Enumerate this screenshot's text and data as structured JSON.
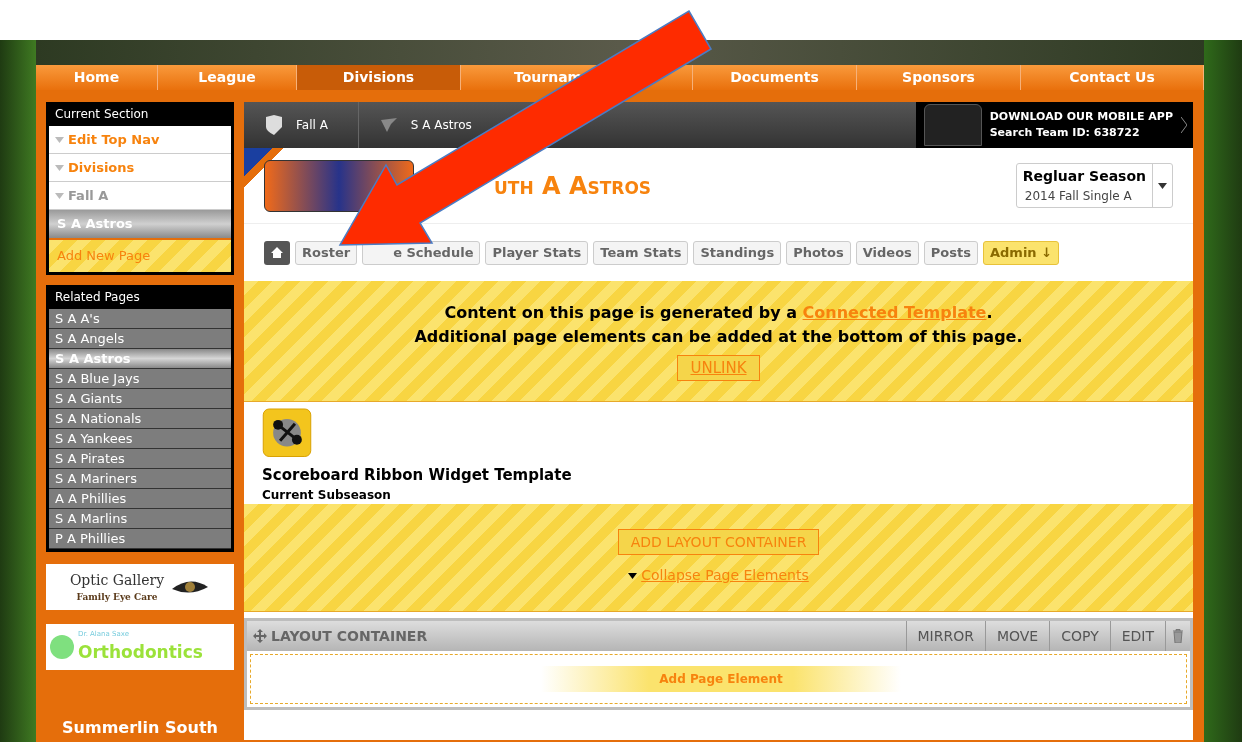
{
  "nav": [
    {
      "label": "Home",
      "selected": false
    },
    {
      "label": "League",
      "selected": false
    },
    {
      "label": "Divisions",
      "selected": true
    },
    {
      "label": "Tournam",
      "selected": false
    },
    {
      "label": "Documents",
      "selected": false
    },
    {
      "label": "Sponsors",
      "selected": false
    },
    {
      "label": "Contact Us",
      "selected": false
    }
  ],
  "current_section": {
    "title": "Current Section",
    "items": [
      {
        "label": "Edit Top Nav",
        "kind": "link"
      },
      {
        "label": "Divisions",
        "kind": "link"
      },
      {
        "label": "Fall A",
        "kind": "muted"
      },
      {
        "label": "S A Astros",
        "kind": "current"
      },
      {
        "label": "Add New Page",
        "kind": "add"
      }
    ]
  },
  "related_pages": {
    "title": "Related Pages",
    "items": [
      {
        "label": "S A A's",
        "selected": false
      },
      {
        "label": "S A Angels",
        "selected": false
      },
      {
        "label": "S A Astros",
        "selected": true
      },
      {
        "label": "S A Blue Jays",
        "selected": false
      },
      {
        "label": "S A Giants",
        "selected": false
      },
      {
        "label": "S A Nationals",
        "selected": false
      },
      {
        "label": "S A Yankees",
        "selected": false
      },
      {
        "label": "S A Pirates",
        "selected": false
      },
      {
        "label": "S A Mariners",
        "selected": false
      },
      {
        "label": "A A Phillies",
        "selected": false
      },
      {
        "label": "S A Marlins",
        "selected": false
      },
      {
        "label": "P A Phillies",
        "selected": false
      }
    ]
  },
  "sponsors": [
    {
      "title": "Optic Gallery",
      "subtitle": "Family Eye Care",
      "kind": "optic"
    },
    {
      "title": "Orthodontics",
      "subtitle": "Dr. Alana Saxe",
      "kind": "ortho"
    },
    {
      "title": "Summerlin South",
      "kind": "league"
    }
  ],
  "breadcrumbs": [
    "Fall A",
    "S A Astros"
  ],
  "app_promo": {
    "title": "DOWNLOAD OUR MOBILE APP",
    "subtitle": "Search Team ID: 638722"
  },
  "team_title": "uth A Astros",
  "season": {
    "title": "Regluar Season",
    "subtitle": "2014 Fall Single A"
  },
  "tabs": [
    {
      "kind": "home"
    },
    {
      "label": "Roster",
      "kind": "tab"
    },
    {
      "label": "e Schedule",
      "kind": "tab"
    },
    {
      "label": "Player Stats",
      "kind": "tab"
    },
    {
      "label": "Team Stats",
      "kind": "tab"
    },
    {
      "label": "Standings",
      "kind": "tab"
    },
    {
      "label": "Photos",
      "kind": "tab"
    },
    {
      "label": "Videos",
      "kind": "tab"
    },
    {
      "label": "Posts",
      "kind": "tab"
    },
    {
      "label": "Admin ↓",
      "kind": "admin"
    }
  ],
  "notice": {
    "before": "Content on this page is generated by a ",
    "link": "Connected Template",
    "after": ".",
    "line2": "Additional page elements can be added at the bottom of this page.",
    "button": "UNLINK"
  },
  "widget": {
    "title": "Scoreboard Ribbon Widget Template",
    "subtitle": "Current Subseason"
  },
  "add_bar": {
    "button": "ADD LAYOUT CONTAINER",
    "link": "Collapse Page Elements"
  },
  "layout_container": {
    "title": "LAYOUT CONTAINER",
    "actions": [
      "MIRROR",
      "MOVE",
      "COPY",
      "EDIT"
    ],
    "add_element": "Add Page Element"
  }
}
